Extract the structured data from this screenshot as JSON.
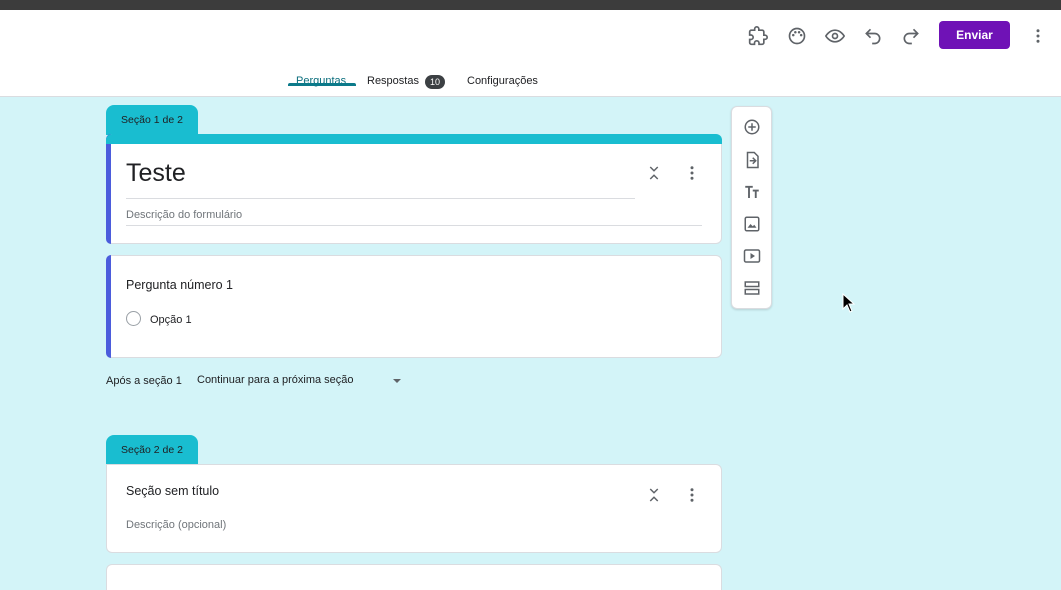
{
  "header": {
    "send_label": "Enviar",
    "icons": [
      "addon-icon",
      "palette-icon",
      "preview-icon",
      "undo-icon",
      "redo-icon",
      "more-vert-icon"
    ]
  },
  "tabs": {
    "questions": "Perguntas",
    "responses": "Respostas",
    "responses_count": "10",
    "settings": "Configurações"
  },
  "section1": {
    "tab_label": "Seção 1 de 2",
    "form_title": "Teste",
    "form_description_placeholder": "Descrição do formulário",
    "question": {
      "title": "Pergunta número 1",
      "option": "Opção 1"
    },
    "after_label": "Após a seção 1",
    "after_value": "Continuar para a próxima seção"
  },
  "section2": {
    "tab_label": "Seção 2 de 2",
    "title": "Seção sem título",
    "description_placeholder": "Descrição (opcional)"
  },
  "colors": {
    "background": "#d3f4f8",
    "accent_teal": "#19bdd0",
    "accent_blue": "#4b5cdc",
    "send_button": "#6f12b6",
    "active_tab": "#0b6e7d"
  },
  "toolbar_icons": [
    "add-question-icon",
    "import-questions-icon",
    "add-title-icon",
    "add-image-icon",
    "add-video-icon",
    "add-section-icon"
  ]
}
